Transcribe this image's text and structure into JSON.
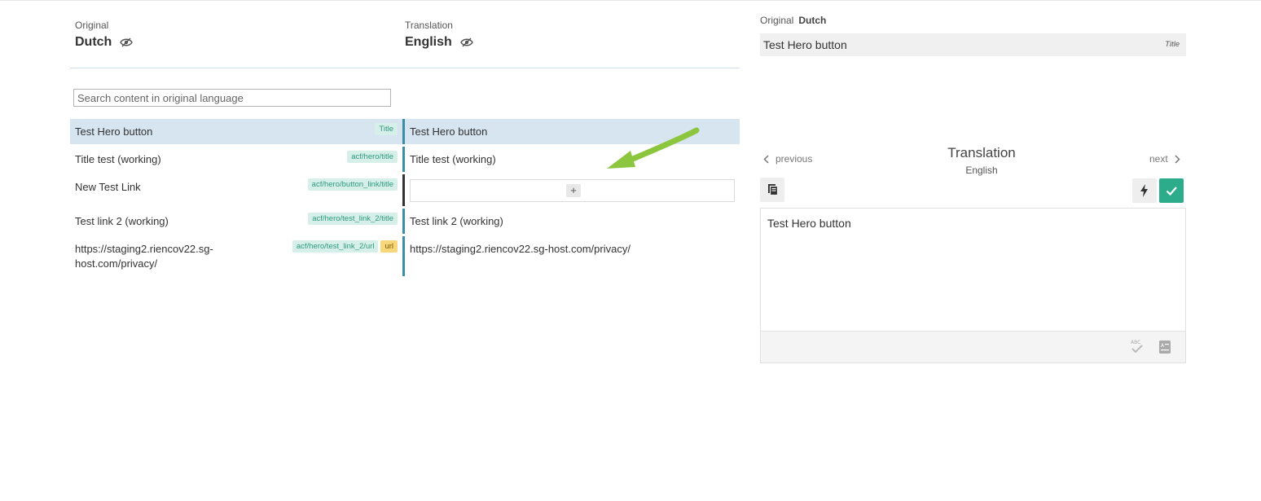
{
  "header": {
    "original_caption": "Original",
    "original_lang": "Dutch",
    "translation_caption": "Translation",
    "translation_lang": "English"
  },
  "search": {
    "placeholder": "Search content in original language",
    "value": ""
  },
  "rows": [
    {
      "original": "Test Hero button",
      "tags": [
        "Title"
      ],
      "translation": "Test Hero button",
      "active": true
    },
    {
      "original": "Title test (working)",
      "tags": [
        "acf/hero/title"
      ],
      "translation": "Title test (working)"
    },
    {
      "original": "New Test Link",
      "tags": [
        "acf/hero/button_link/title"
      ],
      "translation": "",
      "add_label": "+"
    },
    {
      "original": "Test link 2 (working)",
      "tags": [
        "acf/hero/test_link_2/title"
      ],
      "translation": "Test link 2 (working)"
    },
    {
      "original_line1": "https://staging2.riencov22.sg-",
      "original_line2": "host.com/privacy/",
      "tags": [
        "acf/hero/test_link_2/url",
        "url"
      ],
      "translation": "https://staging2.riencov22.sg-host.com/privacy/"
    }
  ],
  "panel": {
    "original_caption": "Original",
    "original_lang": "Dutch",
    "original_text": "Test Hero button",
    "original_type": "Title",
    "prev_label": "previous",
    "next_label": "next",
    "title": "Translation",
    "subtitle": "English",
    "editor_text": "Test Hero button"
  },
  "colors": {
    "accent": "#2cac8a",
    "active_row": "#d6e5ef",
    "separator": "#3a8ea8",
    "tag_bg": "#d7efe9",
    "url_tag_bg": "#f8d77a",
    "arrow": "#8cc63f"
  },
  "icons": {
    "eye": "eye-slash-icon",
    "copy": "copy-icon",
    "bolt": "bolt-icon",
    "check": "check-icon",
    "spell": "spellcheck-icon",
    "dict": "dictionary-icon"
  }
}
